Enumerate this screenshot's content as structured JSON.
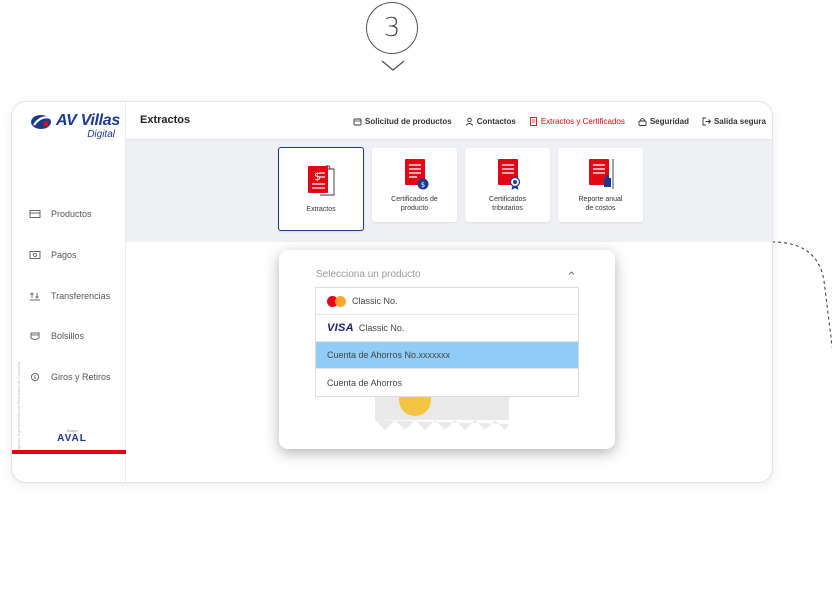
{
  "step": {
    "number": "3"
  },
  "brand": {
    "name": "AV Villas",
    "sub": "Digital",
    "group_small": "Grupo",
    "group_name": "AVAL",
    "vertical_note": "Vigilado Superintendencia Financiera de Colombia",
    "accent": "#e30613",
    "primary": "#1c3a8c"
  },
  "sidebar": {
    "items": [
      {
        "label": "Productos",
        "icon": "wallet-icon"
      },
      {
        "label": "Pagos",
        "icon": "bill-icon"
      },
      {
        "label": "Transferencias",
        "icon": "transfer-icon"
      },
      {
        "label": "Bolsillos",
        "icon": "pocket-icon"
      },
      {
        "label": "Giros y Retiros",
        "icon": "withdraw-icon"
      }
    ]
  },
  "header": {
    "title": "Extractos",
    "menu": [
      {
        "label": "Solicitud de productos",
        "icon": "bag-icon"
      },
      {
        "label": "Contactos",
        "icon": "user-icon"
      },
      {
        "label": "Extractos y Certificados",
        "icon": "document-icon",
        "active": true
      },
      {
        "label": "Seguridad",
        "icon": "lock-icon"
      },
      {
        "label": "Salida segura",
        "icon": "logout-icon"
      }
    ]
  },
  "cards": [
    {
      "line1": "Extractos",
      "line2": "",
      "selected": true,
      "icon": "statement-icon"
    },
    {
      "line1": "Certificados de",
      "line2": "producto",
      "icon": "product-certificate-icon"
    },
    {
      "line1": "Certificados",
      "line2": "tributarios",
      "icon": "tax-certificate-icon"
    },
    {
      "line1": "Reporte anual",
      "line2": "de costos",
      "icon": "annual-report-icon"
    }
  ],
  "select": {
    "placeholder": "Selecciona un producto",
    "options": [
      {
        "label": "Classic No.",
        "brand": "mastercard"
      },
      {
        "label": "Classic No.",
        "brand": "visa",
        "brand_label": "VISA"
      },
      {
        "label": "Cuenta de Ahorros No.xxxxxxx",
        "highlighted": true
      },
      {
        "label": "Cuenta de Ahorros"
      }
    ]
  }
}
